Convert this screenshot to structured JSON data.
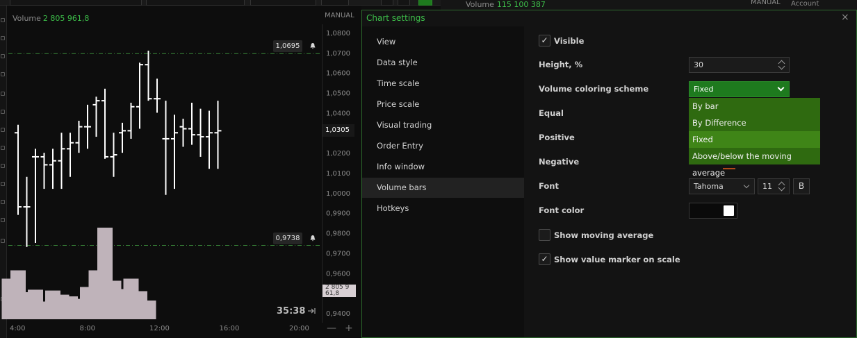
{
  "chart": {
    "volume_label": "Volume",
    "volume_value": "2 805 961,8",
    "manual_label": "MANUAL",
    "y_ticks": [
      "1,0800",
      "1,0700",
      "1,0600",
      "1,0500",
      "1,0400",
      "1,0300",
      "1,0200",
      "1,0100",
      "1,0000",
      "0,9900",
      "0,9800",
      "0,9700",
      "0,9600",
      "0,9500",
      "0,9400"
    ],
    "x_ticks": [
      "4:00",
      "8:00",
      "12:00",
      "16:00",
      "20:00"
    ],
    "marker_high": "1,0695",
    "marker_low": "0,9738",
    "current_price": "1,0305",
    "volume_scale_label": "2 805 9\n61,8",
    "timer": "35:38",
    "zoom_minus": "—",
    "zoom_plus": "+",
    "colors": {
      "bar": "#ffffff",
      "volume": "#bfb3ba",
      "guide": "#3a8a3a"
    }
  },
  "chart_data": {
    "type": "ohlc",
    "ylim": [
      0.94,
      1.085
    ],
    "x": [
      "3:00",
      "3:30",
      "4:00",
      "4:30",
      "5:00",
      "5:30",
      "6:00",
      "6:30",
      "7:00",
      "7:30",
      "8:00",
      "8:30",
      "9:00",
      "9:30",
      "10:00",
      "10:30",
      "11:00",
      "11:30",
      "12:00",
      "12:30",
      "13:00",
      "13:30",
      "14:00",
      "14:30",
      "15:00",
      "15:30",
      "16:00",
      "16:30",
      "17:00",
      "17:30",
      "18:00",
      "18:30",
      "19:00",
      "19:30"
    ],
    "ohlc": [
      [
        1.03,
        1.034,
        0.989,
        0.993
      ],
      [
        0.993,
        1.008,
        0.973,
        0.993
      ],
      [
        1.018,
        1.022,
        0.975,
        1.018
      ],
      [
        1.018,
        1.02,
        1.002,
        1.014
      ],
      [
        1.014,
        1.022,
        1.002,
        1.016
      ],
      [
        1.016,
        1.03,
        1.002,
        1.022
      ],
      [
        1.022,
        1.03,
        1.008,
        1.025
      ],
      [
        1.025,
        1.036,
        1.02,
        1.033
      ],
      [
        1.033,
        1.044,
        1.022,
        1.033
      ],
      [
        1.044,
        1.048,
        1.028,
        1.046
      ],
      [
        1.046,
        1.052,
        1.017,
        1.018
      ],
      [
        1.018,
        1.03,
        1.008,
        1.019
      ],
      [
        1.03,
        1.035,
        1.02,
        1.031
      ],
      [
        1.031,
        1.045,
        1.027,
        1.043
      ],
      [
        1.043,
        1.065,
        1.032,
        1.064
      ],
      [
        1.064,
        1.071,
        1.046,
        1.047
      ],
      [
        1.047,
        1.057,
        1.04,
        1.047
      ],
      [
        1.027,
        1.046,
        0.999,
        1.027
      ],
      [
        1.027,
        1.039,
        1.002,
        1.03
      ],
      [
        1.033,
        1.037,
        1.023,
        1.032
      ],
      [
        1.032,
        1.045,
        1.024,
        1.029
      ],
      [
        1.029,
        1.042,
        1.018,
        1.028
      ],
      [
        1.028,
        1.041,
        1.012,
        1.03
      ],
      [
        1.03,
        1.046,
        1.012,
        1.031
      ]
    ],
    "volume_x": [
      "2:30",
      "3:00",
      "3:30",
      "4:00",
      "4:30",
      "5:00",
      "5:30",
      "6:00",
      "6:30",
      "7:00",
      "7:30",
      "8:00",
      "8:30",
      "9:00",
      "9:30",
      "10:00",
      "10:30"
    ],
    "volume": [
      1.95,
      2.35,
      1.3,
      1.42,
      0.85,
      1.38,
      1.18,
      1.1,
      0.98,
      1.55,
      2.35,
      4.4,
      1.85,
      1.45,
      1.95,
      1.35,
      0.9
    ],
    "volume_unit": "relative",
    "guides": [
      1.0695,
      0.9738
    ]
  },
  "background": {
    "volume_label": "Volume",
    "volume_value": "115 100 387",
    "manual_label": "MANUAL",
    "account_label": "Account"
  },
  "dialog": {
    "title": "Chart settings",
    "close": "×",
    "nav": [
      "View",
      "Data style",
      "Time scale",
      "Price scale",
      "Visual trading",
      "Order Entry",
      "Info window",
      "Volume bars",
      "Hotkeys"
    ],
    "active_nav": "Volume bars",
    "visible_label": "Visible",
    "height_label": "Height, %",
    "height_value": "30",
    "coloring_label": "Volume coloring scheme",
    "coloring_value": "Fixed",
    "coloring_options": [
      "By bar",
      "By Difference",
      "Fixed",
      "Above/below the moving average"
    ],
    "equal_label": "Equal",
    "positive_label": "Positive",
    "negative_label": "Negative",
    "font_label": "Font",
    "font_value": "Tahoma",
    "font_size": "11",
    "bold_label": "B",
    "font_color_label": "Font color",
    "font_color": "#ffffff",
    "show_ma_label": "Show moving average",
    "show_marker_label": "Show value marker on scale",
    "check_mark": "✓",
    "accent": "#3dbf4a"
  }
}
